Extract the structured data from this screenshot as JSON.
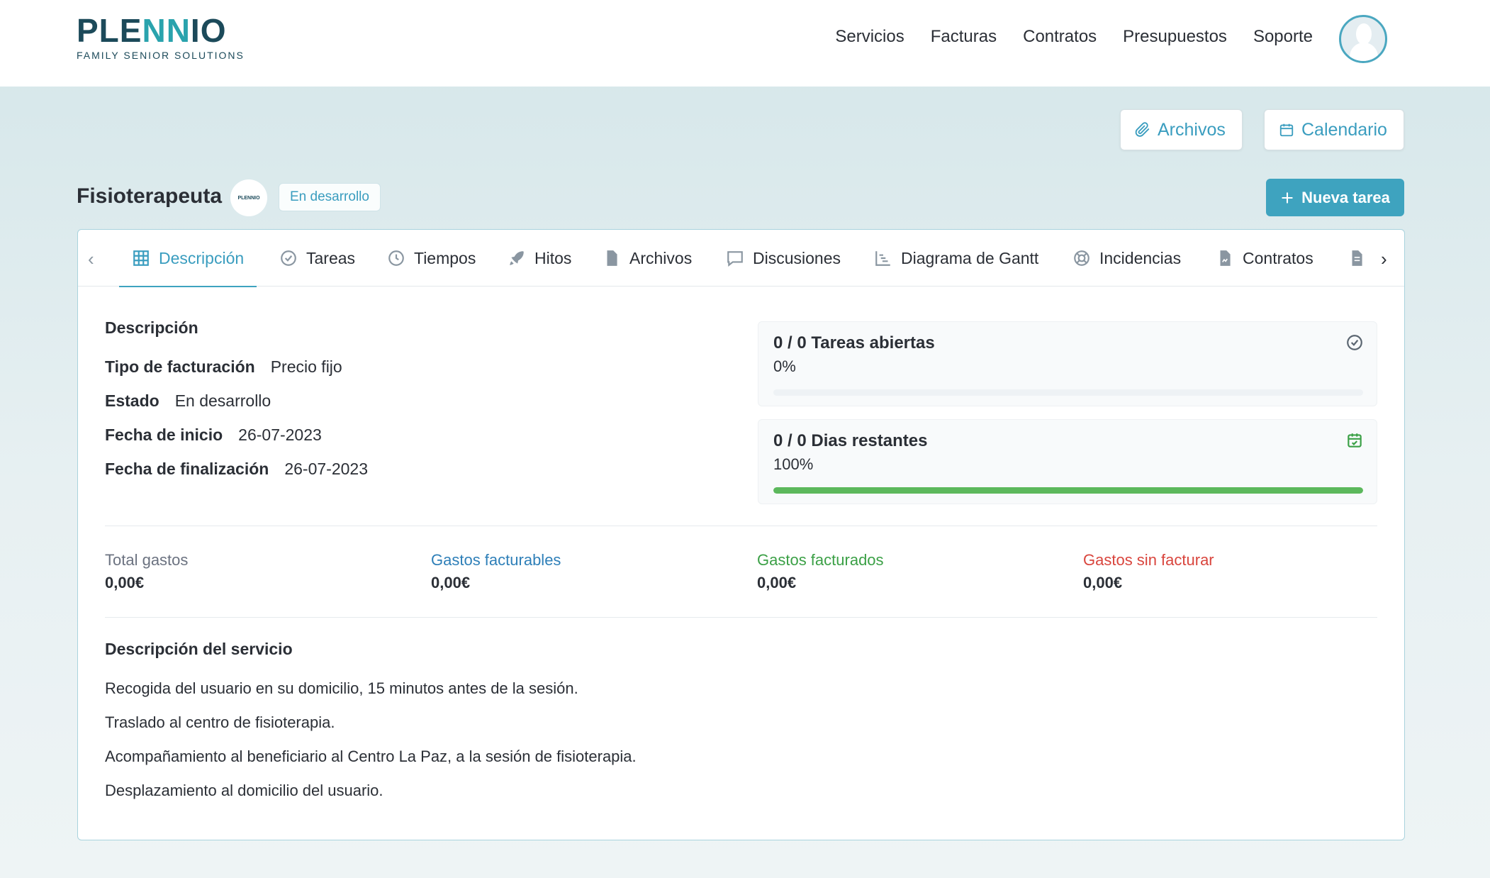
{
  "header": {
    "logo_word_a": "PLE",
    "logo_word_b": "NN",
    "logo_word_c": "IO",
    "logo_sub": "FAMILY SENIOR SOLUTIONS",
    "nav": [
      "Servicios",
      "Facturas",
      "Contratos",
      "Presupuestos",
      "Soporte"
    ]
  },
  "actions": {
    "archivos": "Archivos",
    "calendario": "Calendario",
    "nueva_tarea": "Nueva tarea"
  },
  "project": {
    "title": "Fisioterapeuta",
    "logo_mini": "PLENNIO",
    "status_badge": "En desarrollo"
  },
  "tabs": [
    {
      "label": "Descripción",
      "icon": "grid-icon",
      "active": true
    },
    {
      "label": "Tareas",
      "icon": "check-circle-icon"
    },
    {
      "label": "Tiempos",
      "icon": "clock-icon"
    },
    {
      "label": "Hitos",
      "icon": "rocket-icon"
    },
    {
      "label": "Archivos",
      "icon": "file-icon"
    },
    {
      "label": "Discusiones",
      "icon": "comment-icon"
    },
    {
      "label": "Diagrama de Gantt",
      "icon": "gantt-icon"
    },
    {
      "label": "Incidencias",
      "icon": "lifebuoy-icon"
    },
    {
      "label": "Contratos",
      "icon": "contract-icon"
    }
  ],
  "details": {
    "section_title": "Descripción",
    "rows": [
      {
        "key": "Tipo de facturación",
        "value": "Precio fijo"
      },
      {
        "key": "Estado",
        "value": "En desarrollo"
      },
      {
        "key": "Fecha de inicio",
        "value": "26-07-2023"
      },
      {
        "key": "Fecha de finalización",
        "value": "26-07-2023"
      }
    ]
  },
  "stats": {
    "tasks": {
      "title": "0 / 0 Tareas abiertas",
      "percent_text": "0%",
      "progress": 0
    },
    "days": {
      "title": "0 / 0 Dias restantes",
      "percent_text": "100%",
      "progress": 1.0
    }
  },
  "expenses": [
    {
      "label": "Total gastos",
      "value": "0,00€",
      "color": "#6b7280"
    },
    {
      "label": "Gastos facturables",
      "value": "0,00€",
      "color": "#2e7fb8"
    },
    {
      "label": "Gastos facturados",
      "value": "0,00€",
      "color": "#3ba046"
    },
    {
      "label": "Gastos sin facturar",
      "value": "0,00€",
      "color": "#d9453d"
    }
  ],
  "service": {
    "title": "Descripción del servicio",
    "lines": [
      "Recogida del usuario en su domicilio, 15 minutos antes de la sesión.",
      "Traslado al centro de fisioterapia.",
      "Acompañamiento al beneficiario al Centro La Paz, a la sesión de fisioterapia.",
      "Desplazamiento al domicilio del usuario."
    ]
  },
  "colors": {
    "accent": "#3ea3bf",
    "progress_green": "#5cb85c"
  }
}
